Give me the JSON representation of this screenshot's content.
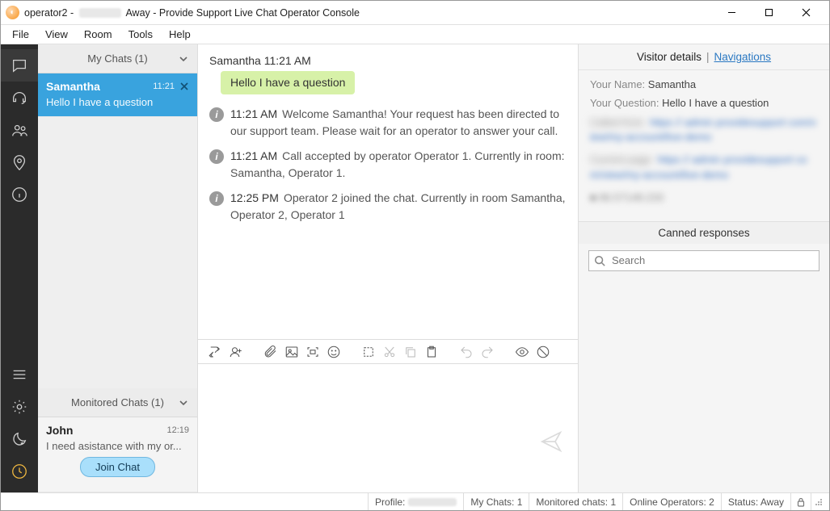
{
  "window": {
    "operator": "operator2",
    "status_word": "Away",
    "title_suffix": "Provide Support Live Chat Operator Console"
  },
  "menu": {
    "items": [
      "File",
      "View",
      "Room",
      "Tools",
      "Help"
    ]
  },
  "rail": {
    "icons": [
      "chat-bubble-icon",
      "headset-icon",
      "people-icon",
      "map-pin-icon",
      "info-icon"
    ],
    "bottom_icons": [
      "hamburger-icon",
      "gear-icon",
      "moon-icon",
      "clock-icon"
    ]
  },
  "mychats": {
    "header": "My Chats (1)",
    "items": [
      {
        "name": "Samantha",
        "time": "11:21",
        "preview": "Hello I have a question",
        "selected": true
      }
    ]
  },
  "monitored": {
    "header": "Monitored Chats (1)",
    "items": [
      {
        "name": "John",
        "time": "12:19",
        "preview": "I need asistance with my or...",
        "join_label": "Join Chat"
      }
    ]
  },
  "conversation": {
    "header_name": "Samantha",
    "header_time": "11:21 AM",
    "visitor_bubble": "Hello I have a question",
    "events": [
      {
        "time": "11:21 AM",
        "text": "Welcome Samantha! Your request has been directed to our support team. Please wait for an operator to answer your call."
      },
      {
        "time": "11:21 AM",
        "text": "Call accepted by operator Operator 1. Currently in room: Samantha, Operator 1."
      },
      {
        "time": "12:25 PM",
        "text": "Operator 2 joined the chat. Currently in room Samantha, Operator 2, Operator 1"
      }
    ]
  },
  "compose": {
    "placeholder": ""
  },
  "details": {
    "tab_details": "Visitor details",
    "tab_nav": "Navigations",
    "name_label": "Your Name:",
    "name_value": "Samantha",
    "question_label": "Your Question:",
    "question_value": "Hello I have a question",
    "canned_header": "Canned responses",
    "search_placeholder": "Search"
  },
  "statusbar": {
    "profile_label": "Profile:",
    "mychats": "My Chats: 1",
    "monitored": "Monitored chats: 1",
    "online_ops": "Online Operators: 2",
    "status": "Status: Away"
  }
}
